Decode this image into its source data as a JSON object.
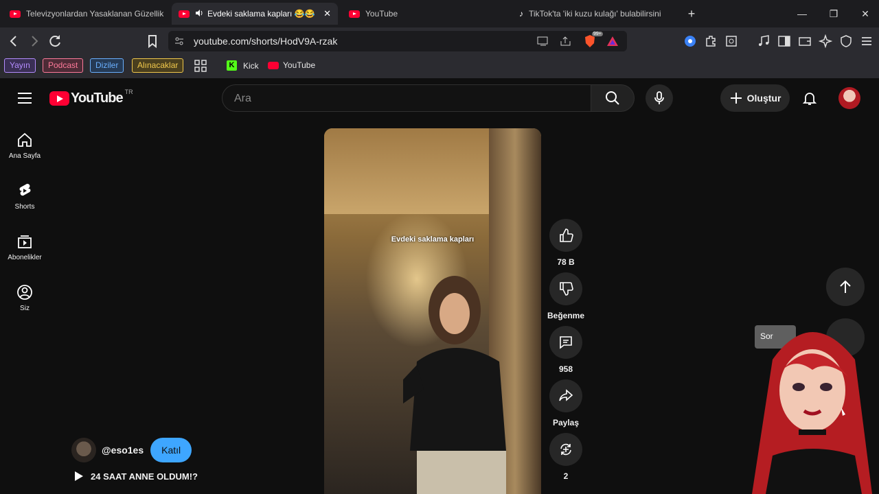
{
  "browser": {
    "tabs": [
      {
        "title": "Televizyonlardan Yasaklanan Güzellik",
        "active": false
      },
      {
        "title": "Evdeki saklama kapları 😂😂",
        "active": true
      },
      {
        "title": "YouTube",
        "active": false
      },
      {
        "title": "TikTok'ta 'iki kuzu kulağı' bulabilirsini",
        "active": false
      }
    ],
    "url": "youtube.com/shorts/HodV9A-rzak",
    "extension_badge": "99+",
    "bookmarks": [
      {
        "label": "Yayın",
        "color": "#b48cff"
      },
      {
        "label": "Podcast",
        "color": "#ff7a9a"
      },
      {
        "label": "Diziler",
        "color": "#6ab0ff"
      },
      {
        "label": "Alınacaklar",
        "color": "#f2c94c"
      }
    ],
    "bookmark_links": [
      {
        "label": "Kick"
      },
      {
        "label": "YouTube"
      }
    ]
  },
  "youtube": {
    "logo_text": "YouTube",
    "region": "TR",
    "search_placeholder": "Ara",
    "create_label": "Oluştur",
    "sidebar": [
      {
        "label": "Ana Sayfa",
        "icon": "home-icon"
      },
      {
        "label": "Shorts",
        "icon": "shorts-icon"
      },
      {
        "label": "Abonelikler",
        "icon": "subscriptions-icon"
      },
      {
        "label": "Siz",
        "icon": "you-icon"
      }
    ],
    "short": {
      "caption": "Evdeki saklama kapları",
      "channel": "@eso1es",
      "join_label": "Katıl",
      "playlist_title": "24 SAAT ANNE OLDUM!?",
      "actions": [
        {
          "label": "78 B",
          "icon": "like-icon"
        },
        {
          "label": "Beğenme",
          "icon": "dislike-icon"
        },
        {
          "label": "958",
          "icon": "comment-icon"
        },
        {
          "label": "Paylaş",
          "icon": "share-icon"
        },
        {
          "label": "2",
          "icon": "remix-icon"
        }
      ]
    },
    "tooltip": "Sor"
  }
}
